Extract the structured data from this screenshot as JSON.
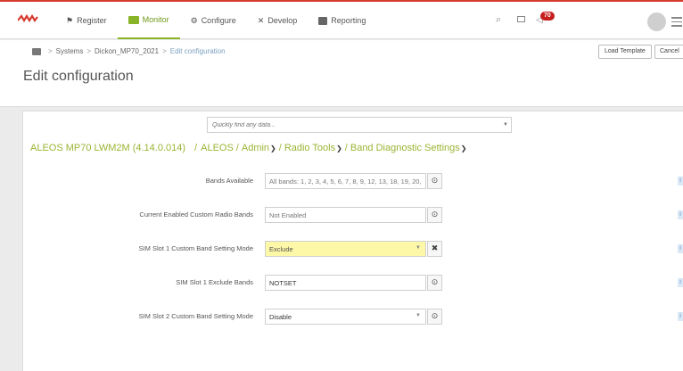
{
  "nav": {
    "register": "Register",
    "monitor": "Monitor",
    "configure": "Configure",
    "develop": "Develop",
    "reporting": "Reporting"
  },
  "notifications": {
    "count": "70"
  },
  "breadcrumb": {
    "systems": "Systems",
    "device": "Dickon_MP70_2021",
    "current": "Edit configuration"
  },
  "page": {
    "title": "Edit configuration"
  },
  "buttons": {
    "load_template": "Load Template",
    "cancel": "Cancel"
  },
  "search": {
    "placeholder": "Quickly find any data..."
  },
  "path": {
    "device": "ALEOS MP70 LWM2M (4.14.0.014)",
    "aleos": "ALEOS",
    "admin": "Admin",
    "radio_tools": "Radio Tools",
    "band_diag": "Band Diagnostic Settings"
  },
  "rows": [
    {
      "label": "Bands Available",
      "value": "All bands: 1, 2, 3, 4, 5, 6, 7, 8, 9, 12, 13, 18, 19, 20,",
      "action_icon": "refresh-icon"
    },
    {
      "label": "Current Enabled Custom Radio Bands",
      "value": "Not Enabled",
      "action_icon": "refresh-icon"
    },
    {
      "label": "SIM Slot 1 Custom Band Setting Mode",
      "value": "Exclude",
      "action_icon": "clear-icon",
      "highlight": "#fdf7a8"
    },
    {
      "label": "SIM Slot 1 Exclude Bands",
      "value": "NOTSET",
      "action_icon": "refresh-icon"
    },
    {
      "label": "SIM Slot 2 Custom Band Setting Mode",
      "value": "Disable",
      "action_icon": "refresh-icon"
    }
  ],
  "colors": {
    "accent": "#8ab428",
    "brand_red": "#d63b2f",
    "path_green": "#9ab433"
  }
}
